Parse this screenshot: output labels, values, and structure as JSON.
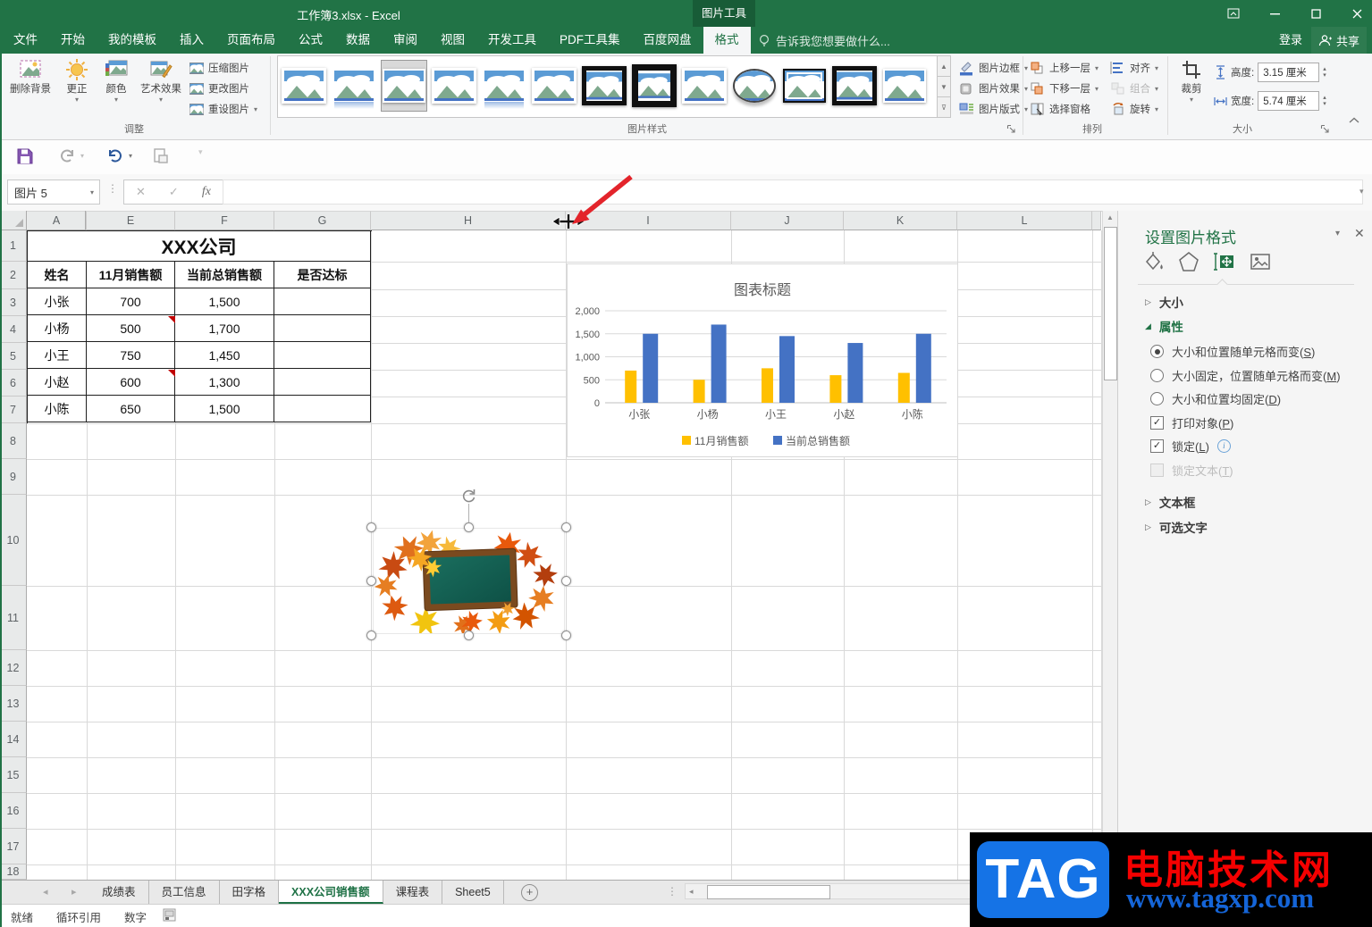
{
  "titlebar": {
    "title": "工作簿3.xlsx - Excel",
    "context_group": "图片工具"
  },
  "menu": {
    "tabs": [
      "文件",
      "开始",
      "我的模板",
      "插入",
      "页面布局",
      "公式",
      "数据",
      "审阅",
      "视图",
      "开发工具",
      "PDF工具集",
      "百度网盘",
      "格式"
    ],
    "active_tab": "格式",
    "tellme": "告诉我您想要做什么...",
    "login": "登录",
    "share": "共享"
  },
  "ribbon": {
    "adjust": {
      "label": "调整",
      "big_buttons": [
        "删除背景",
        "更正",
        "颜色",
        "艺术效果"
      ],
      "small_buttons": [
        "压缩图片",
        "更改图片",
        "重设图片"
      ]
    },
    "styles": {
      "label": "图片样式"
    },
    "style_menu": [
      "图片边框",
      "图片效果",
      "图片版式"
    ],
    "arrange": {
      "label": "排列",
      "col1": [
        "上移一层",
        "下移一层",
        "选择窗格"
      ],
      "col2": [
        "对齐",
        "组合",
        "旋转"
      ]
    },
    "size": {
      "label": "大小",
      "crop": "裁剪",
      "height_label": "高度:",
      "height_value": "3.15 厘米",
      "width_label": "宽度:",
      "width_value": "5.74 厘米"
    }
  },
  "formula_bar": {
    "name_box": "图片 5",
    "fx_label": "fx",
    "value": ""
  },
  "sheet": {
    "columns": [
      "A",
      "E",
      "F",
      "G",
      "H",
      "I",
      "J",
      "K",
      "L"
    ],
    "rows": [
      "1",
      "2",
      "3",
      "4",
      "5",
      "6",
      "7",
      "8",
      "9",
      "10",
      "11",
      "12",
      "13",
      "14",
      "15",
      "16",
      "17",
      "18"
    ],
    "table": {
      "title": "XXX公司",
      "headers": [
        "姓名",
        "11月销售额",
        "当前总销售额",
        "是否达标"
      ],
      "rows": [
        [
          "小张",
          "700",
          "1,500",
          ""
        ],
        [
          "小杨",
          "500",
          "1,700",
          ""
        ],
        [
          "小王",
          "750",
          "1,450",
          ""
        ],
        [
          "小赵",
          "600",
          "1,300",
          ""
        ],
        [
          "小陈",
          "650",
          "1,500",
          ""
        ]
      ],
      "comment_data_rows": [
        1,
        3
      ]
    }
  },
  "chart_data": {
    "type": "bar",
    "title": "图表标题",
    "categories": [
      "小张",
      "小杨",
      "小王",
      "小赵",
      "小陈"
    ],
    "series": [
      {
        "name": "11月销售额",
        "color": "#FFC000",
        "values": [
          700,
          500,
          750,
          600,
          650
        ]
      },
      {
        "name": "当前总销售额",
        "color": "#4472C4",
        "values": [
          1500,
          1700,
          1450,
          1300,
          1500
        ]
      }
    ],
    "ylim": [
      0,
      2000
    ],
    "yticks": [
      "0",
      "500",
      "1,000",
      "1,500",
      "2,000"
    ],
    "legend_position": "bottom",
    "grid": true
  },
  "sheet_tabs": [
    {
      "label": "成绩表",
      "active": false
    },
    {
      "label": "员工信息",
      "active": false
    },
    {
      "label": "田字格",
      "active": false
    },
    {
      "label": "XXX公司销售额",
      "active": true
    },
    {
      "label": "课程表",
      "active": false
    },
    {
      "label": "Sheet5",
      "active": false
    }
  ],
  "status_bar": {
    "ready": "就绪",
    "items": [
      "循环引用",
      "数字"
    ]
  },
  "taskpane": {
    "title": "设置图片格式",
    "tab_icons": [
      "fill-icon",
      "effects-icon",
      "size-properties-icon",
      "picture-icon"
    ],
    "size_section": "大小",
    "properties_section": "属性",
    "options": [
      {
        "type": "radio",
        "label": "大小和位置随单元格而变(S)",
        "checked": true,
        "disabled": false,
        "info": false
      },
      {
        "type": "radio",
        "label": "大小固定，位置随单元格而变(M)",
        "checked": false,
        "disabled": false,
        "info": false
      },
      {
        "type": "radio",
        "label": "大小和位置均固定(D)",
        "checked": false,
        "disabled": false,
        "info": false
      },
      {
        "type": "checkbox",
        "label": "打印对象(P)",
        "checked": true,
        "disabled": false,
        "info": false
      },
      {
        "type": "checkbox",
        "label": "锁定(L)",
        "checked": true,
        "disabled": false,
        "info": true
      },
      {
        "type": "checkbox",
        "label": "锁定文本(T)",
        "checked": false,
        "disabled": true,
        "info": false
      }
    ],
    "textbox_section": "文本框",
    "alttext_section": "可选文字"
  },
  "watermark": {
    "logo": "TAG",
    "title": "电脑技术网",
    "url": "www.tagxp.com"
  },
  "colors": {
    "excel_green": "#217346",
    "series_yellow": "#FFC000",
    "series_blue": "#4472C4",
    "arrow_red": "#E3242B"
  }
}
